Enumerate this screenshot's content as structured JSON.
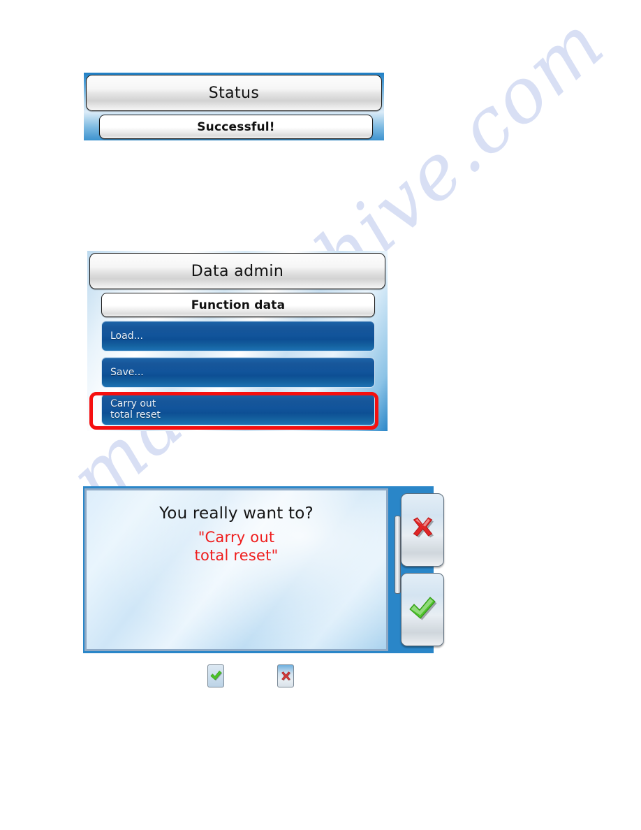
{
  "document": {
    "watermark": "manualshive.com"
  },
  "panels": {
    "status": {
      "title": "Status",
      "message": "Successful!"
    },
    "data_admin": {
      "title": "Data admin",
      "subtitle": "Function data",
      "menu_items": [
        {
          "label": "Load...",
          "highlighted": false
        },
        {
          "label": "Save...",
          "highlighted": false
        },
        {
          "label_line1": "Carry out",
          "label_line2": "total reset",
          "highlighted": true
        }
      ],
      "highlight_color": "#f50f0f"
    },
    "confirm_dialog": {
      "question": "You really want to?",
      "target_line1": "\"Carry out",
      "target_line2": "total reset\"",
      "question_color": "#141414",
      "target_color": "#ef1c1c",
      "buttons": [
        {
          "name": "cancel",
          "icon": "cross-icon",
          "color": "#e03030"
        },
        {
          "name": "confirm",
          "icon": "check-icon",
          "color": "#4cc228"
        }
      ]
    }
  },
  "legend": {
    "items": [
      {
        "icon": "check-icon",
        "color": "#4cc228"
      },
      {
        "icon": "cross-icon",
        "color": "#d03a3a"
      }
    ]
  }
}
